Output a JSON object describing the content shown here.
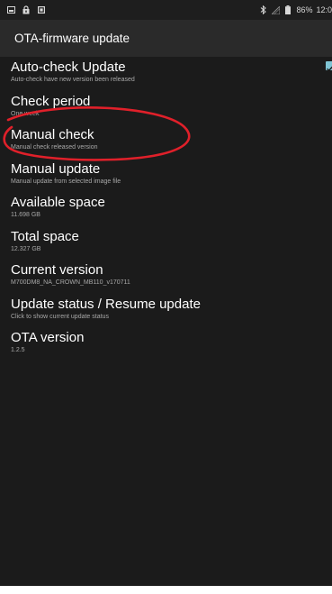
{
  "status_bar": {
    "icons": [
      "screenshot-icon",
      "lock-icon",
      "notification-icon",
      "bluetooth-icon",
      "signal-icon",
      "battery-icon"
    ],
    "battery": "86%",
    "time": "12:0"
  },
  "app_bar": {
    "title": "OTA-firmware update"
  },
  "preferences": [
    {
      "title": "Auto-check Update",
      "summary": "Auto-check have new version been released",
      "checked": true
    },
    {
      "title": "Check period",
      "summary": "One week"
    },
    {
      "title": "Manual check",
      "summary": "Manual check released version"
    },
    {
      "title": "Manual update",
      "summary": "Manual update from selected image file"
    },
    {
      "title": "Available space",
      "summary": "11.698 GB"
    },
    {
      "title": "Total space",
      "summary": "12.327 GB"
    },
    {
      "title": "Current version",
      "summary": "M700DM8_NA_CROWN_MB110_v170711"
    },
    {
      "title": "Update status / Resume update",
      "summary": "Click to show current update status"
    },
    {
      "title": "OTA version",
      "summary": "1.2.5"
    }
  ],
  "colors": {
    "background": "#1b1b1b",
    "app_bar": "#2a2a2a",
    "annotation": "#e0202a",
    "checkbox": "#7fc4d4"
  }
}
